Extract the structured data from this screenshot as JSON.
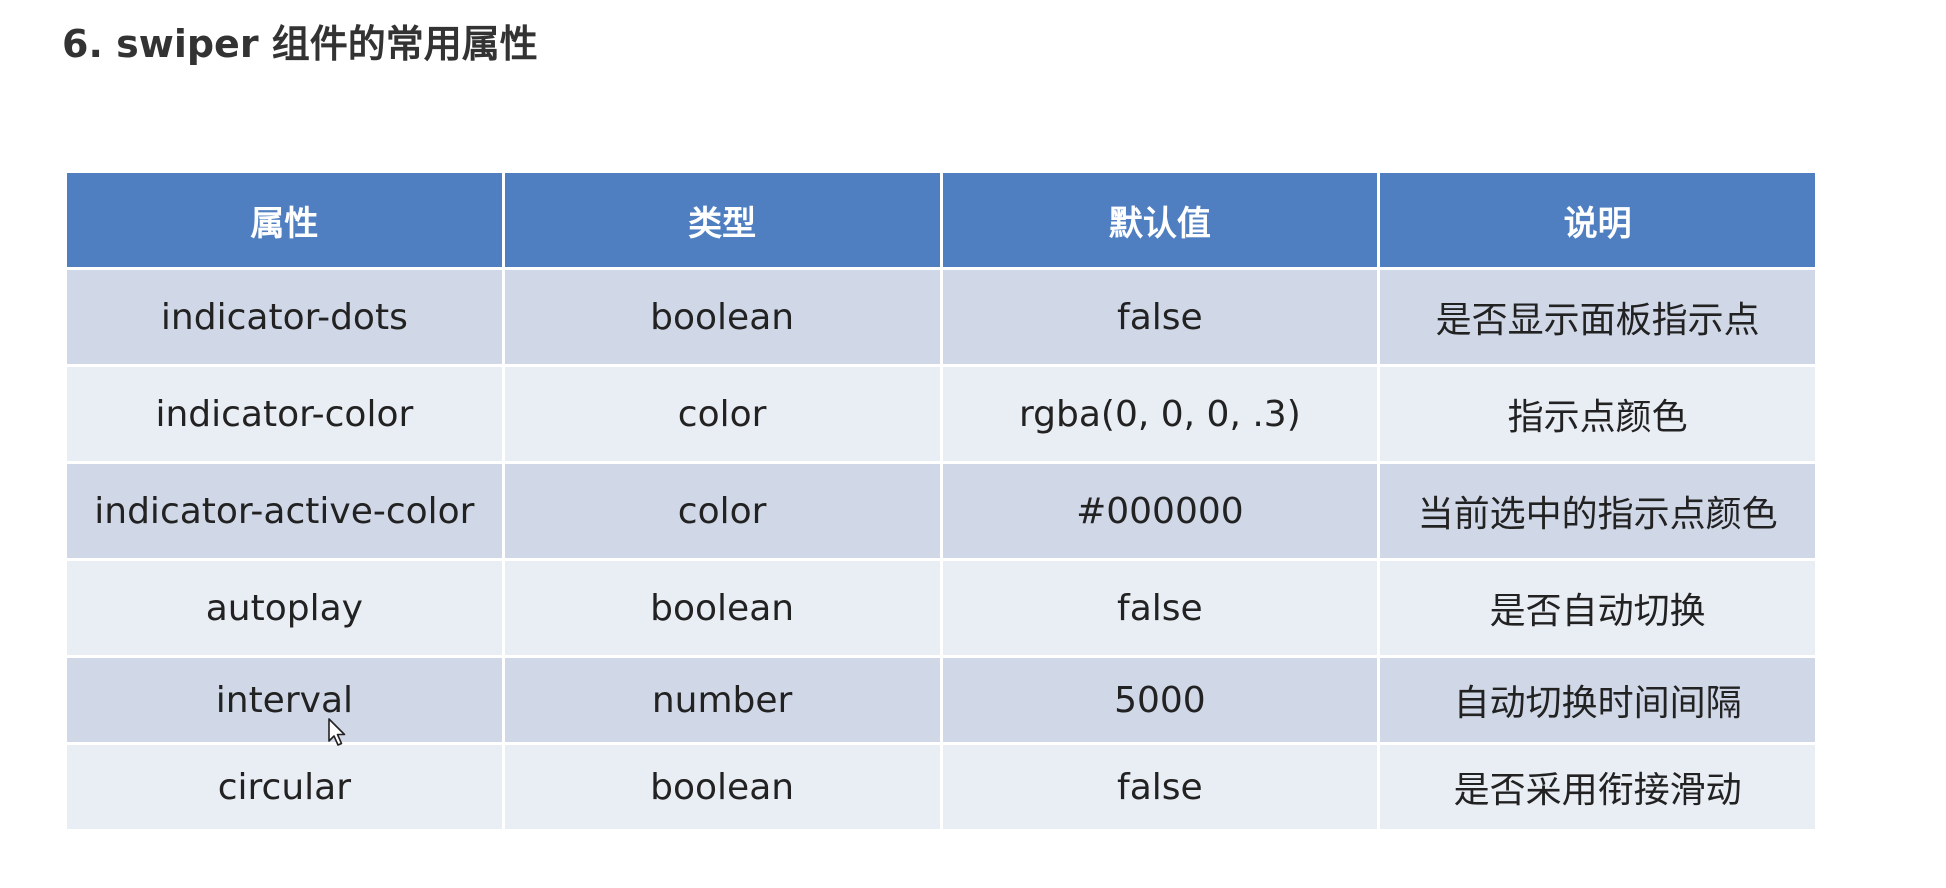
{
  "page": {
    "title": "6. swiper 组件的常用属性"
  },
  "table": {
    "headers": [
      "属性",
      "类型",
      "默认值",
      "说明"
    ],
    "rows": [
      [
        "indicator-dots",
        "boolean",
        "false",
        "是否显示面板指示点"
      ],
      [
        "indicator-color",
        "color",
        "rgba(0, 0, 0, .3)",
        "指示点颜色"
      ],
      [
        "indicator-active-color",
        "color",
        "#000000",
        "当前选中的指示点颜色"
      ],
      [
        "autoplay",
        "boolean",
        "false",
        "是否自动切换"
      ],
      [
        "interval",
        "number",
        "5000",
        "自动切换时间间隔"
      ],
      [
        "circular",
        "boolean",
        "false",
        "是否采用衔接滑动"
      ]
    ]
  },
  "colors": {
    "header_bg": "#4f7fc1",
    "row_odd_bg": "#d0d8e8",
    "row_even_bg": "#e9edf4"
  },
  "icons": {
    "cursor": "mouse-pointer-icon"
  }
}
